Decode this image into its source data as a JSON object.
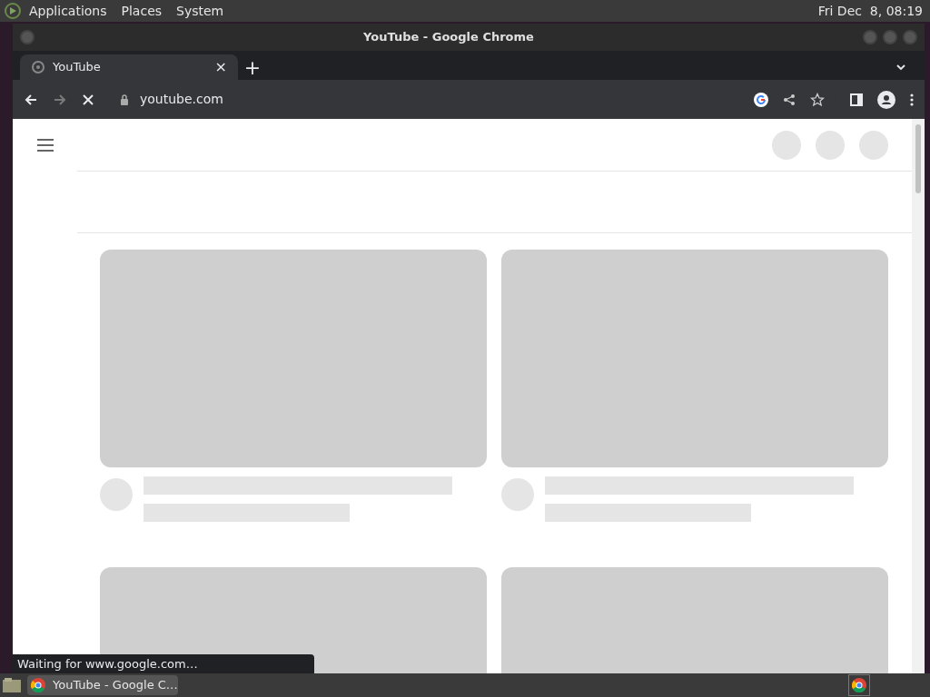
{
  "top_panel": {
    "menus": [
      "Applications",
      "Places",
      "System"
    ],
    "clock": "Fri Dec  8, 08:19"
  },
  "window": {
    "title": "YouTube - Google Chrome"
  },
  "tabs": [
    {
      "label": "YouTube",
      "selected": true,
      "close": "×"
    }
  ],
  "new_tab": "+",
  "address_bar": {
    "url": "youtube.com"
  },
  "status_bubble": "Waiting for www.google.com…",
  "taskbar": {
    "items": [
      {
        "label": "YouTube - Google C…",
        "selected": true
      }
    ]
  }
}
